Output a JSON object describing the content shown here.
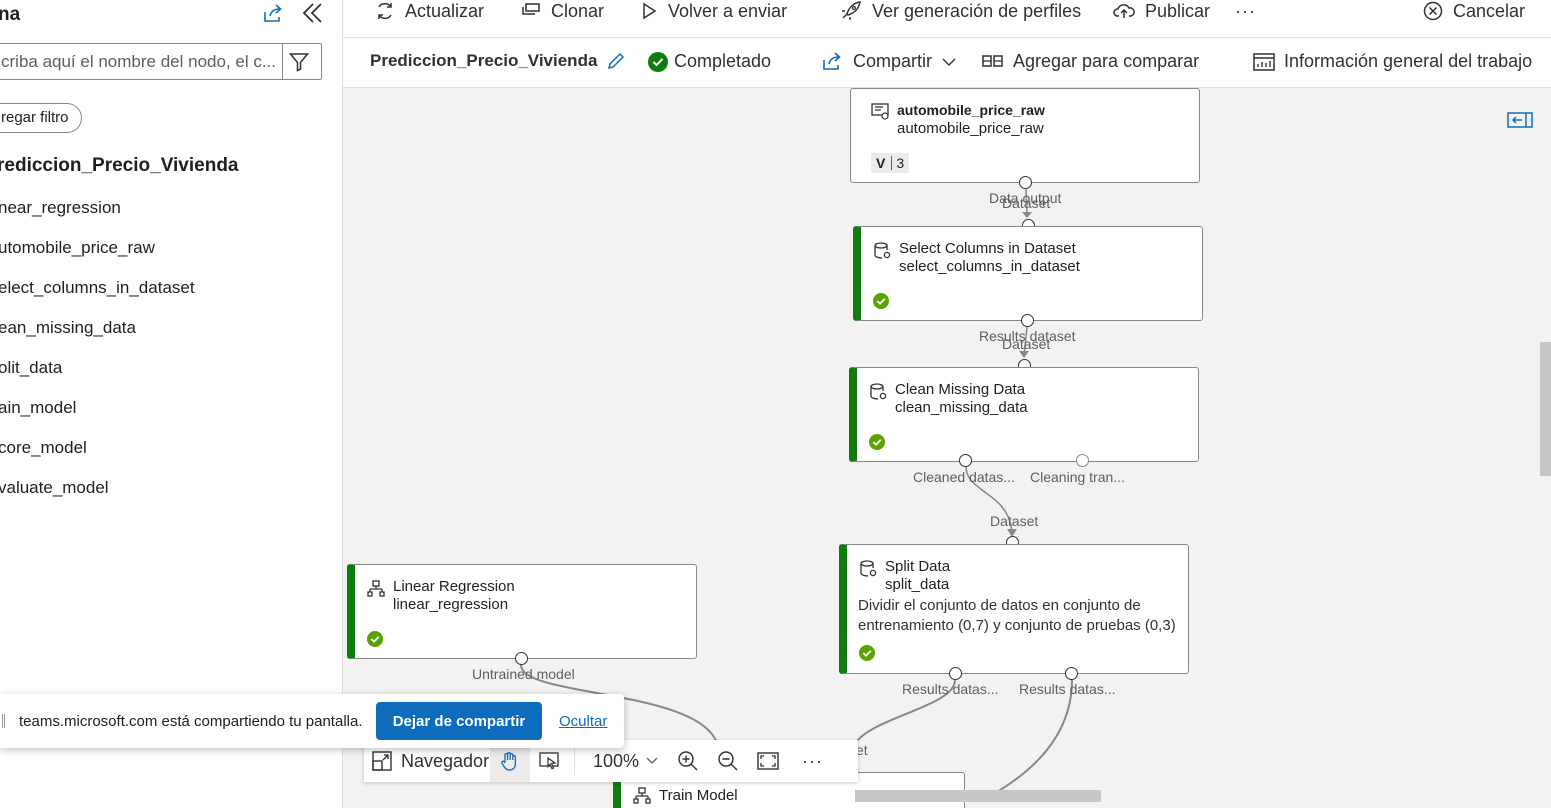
{
  "sidebar": {
    "title": "na",
    "search_placeholder": "criba aquí el nombre del nodo, el c...",
    "add_filter_label": "regar filtro",
    "pipeline_name": "rediccion_Precio_Vivienda",
    "items": [
      {
        "label": "near_regression"
      },
      {
        "label": "utomobile_price_raw"
      },
      {
        "label": "elect_columns_in_dataset"
      },
      {
        "label": "ean_missing_data"
      },
      {
        "label": "olit_data"
      },
      {
        "label": "ain_model"
      },
      {
        "label": "core_model"
      },
      {
        "label": "valuate_model"
      }
    ]
  },
  "toolbar": {
    "refresh_label": "Actualizar",
    "clone_label": "Clonar",
    "resubmit_label": "Volver a enviar",
    "profiling_label": "Ver generación de perfiles",
    "publish_label": "Publicar",
    "more_label": "···",
    "cancel_label": "Cancelar"
  },
  "job": {
    "name": "Prediccion_Precio_Vivienda",
    "status": "Completado",
    "share_label": "Compartir",
    "compare_label": "Agregar para comparar",
    "overview_label": "Información general del trabajo"
  },
  "nodes": {
    "automobile": {
      "title": "automobile_price_raw",
      "subtitle": "automobile_price_raw",
      "version_prefix": "V",
      "version": "3",
      "out_label": "Data output"
    },
    "select": {
      "in_label": "Dataset",
      "title": "Select Columns in Dataset",
      "subtitle": "select_columns_in_dataset",
      "out_label": "Results dataset"
    },
    "clean": {
      "in_label": "Dataset",
      "title": "Clean Missing Data",
      "subtitle": "clean_missing_data",
      "out1_label": "Cleaned datas...",
      "out2_label": "Cleaning tran..."
    },
    "split": {
      "in_label": "Dataset",
      "title": "Split Data",
      "subtitle": "split_data",
      "description": "Dividir el conjunto de datos en conjunto de entrenamiento (0,7) y conjunto de pruebas (0,3)",
      "out1_label": "Results datas...",
      "out2_label": "Results datas..."
    },
    "linear": {
      "title": "Linear Regression",
      "subtitle": "linear_regression",
      "out_label": "Untrained model"
    },
    "train": {
      "title": "Train Model",
      "in_label_partial": "et"
    }
  },
  "share_bar": {
    "text": "teams.microsoft.com está compartiendo tu pantalla.",
    "stop_label": "Dejar de compartir",
    "hide_label": "Ocultar"
  },
  "navigator": {
    "label": "Navegador",
    "zoom": "100%",
    "more_label": "···"
  },
  "colors": {
    "accent": "#0f6cbd",
    "success": "#107c10",
    "canvas": "#f3f2f1"
  }
}
